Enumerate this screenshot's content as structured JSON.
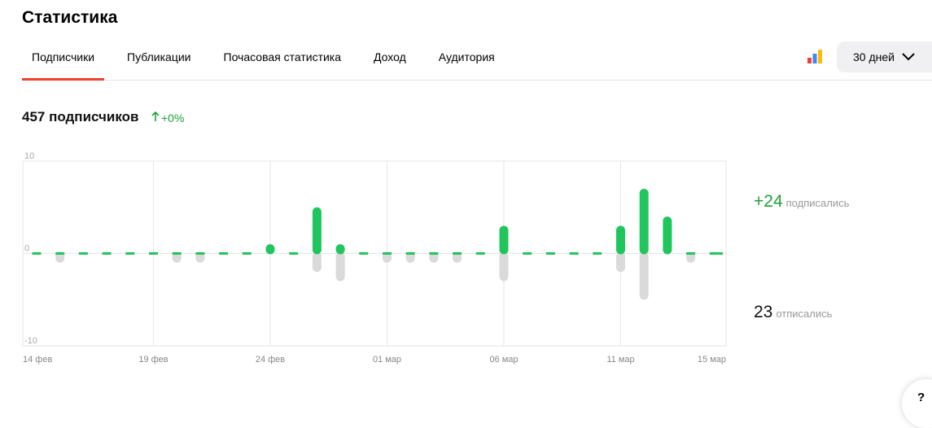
{
  "page": {
    "title": "Статистика"
  },
  "tabs": [
    {
      "label": "Подписчики",
      "active": true
    },
    {
      "label": "Публикации",
      "active": false
    },
    {
      "label": "Почасовая статистика",
      "active": false
    },
    {
      "label": "Доход",
      "active": false
    },
    {
      "label": "Аудитория",
      "active": false
    }
  ],
  "toolbar": {
    "period_label": "30 дней",
    "icon": "yandex-metrica-icon",
    "period_icon": "chevron-down-icon"
  },
  "summary": {
    "count_text": "457 подписчиков",
    "delta_text": "+0%",
    "delta_icon": "arrow-up-icon"
  },
  "stats": {
    "subscribed_value": "+24",
    "subscribed_label": "подписались",
    "unsubscribed_value": "23",
    "unsubscribed_label": "отписались"
  },
  "help": {
    "label": "?"
  },
  "colors": {
    "accent": "#f0412b",
    "positive": "#21c55d",
    "negative": "#dadada",
    "delta": "#21a038"
  },
  "chart_data": {
    "type": "bar",
    "ylim": [
      -10,
      10
    ],
    "yticks": [
      10,
      0,
      -10
    ],
    "xticks": [
      {
        "index": 0,
        "label": "14 фев"
      },
      {
        "index": 5,
        "label": "19 фев"
      },
      {
        "index": 10,
        "label": "24 фев"
      },
      {
        "index": 15,
        "label": "01 мар"
      },
      {
        "index": 20,
        "label": "06 мар"
      },
      {
        "index": 25,
        "label": "11 мар"
      },
      {
        "index": 29,
        "label": "15 мар"
      }
    ],
    "series": [
      {
        "values": [
          0,
          0,
          0,
          0,
          0,
          0,
          0,
          0,
          0,
          0,
          1,
          0,
          5,
          1,
          0,
          0,
          0,
          0,
          0,
          0,
          3,
          0,
          0,
          0,
          0,
          3,
          7,
          4,
          0,
          0,
          0
        ]
      },
      {
        "values": [
          0,
          -1,
          0,
          0,
          0,
          0,
          -1,
          -1,
          0,
          0,
          0,
          0,
          -2,
          -3,
          0,
          -1,
          -1,
          -1,
          -1,
          0,
          -3,
          0,
          0,
          0,
          0,
          -2,
          -5,
          0,
          -1,
          0,
          0
        ]
      }
    ]
  }
}
